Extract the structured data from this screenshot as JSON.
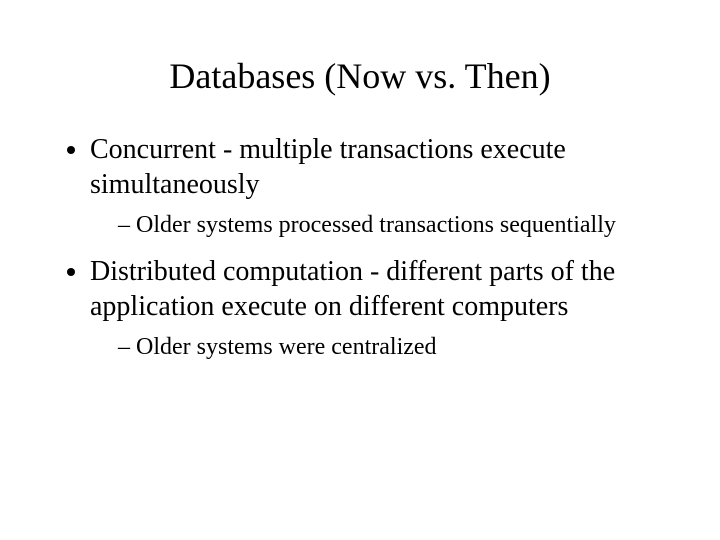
{
  "title": "Databases (Now vs. Then)",
  "bullets": [
    {
      "text": "Concurrent - multiple transactions execute simultaneously",
      "sub": [
        {
          "text": "Older systems processed transactions sequentially"
        }
      ]
    },
    {
      "text": "Distributed computation - different parts of the application execute on different computers",
      "sub": [
        {
          "text": "Older systems were centralized"
        }
      ]
    }
  ]
}
